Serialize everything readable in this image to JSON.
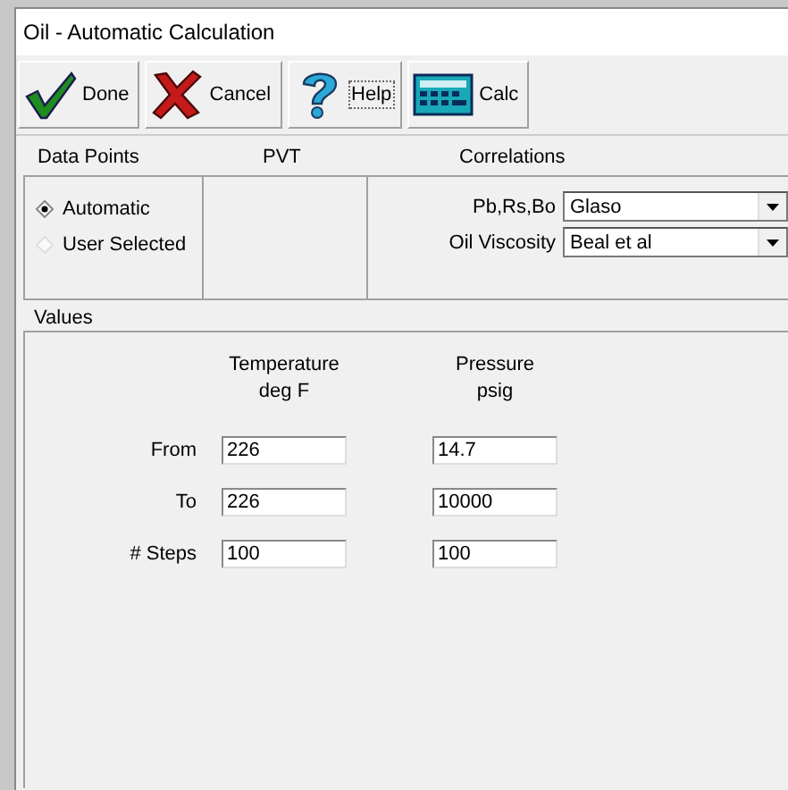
{
  "window": {
    "title": "Oil - Automatic Calculation"
  },
  "toolbar": [
    {
      "kind": "done",
      "label": "Done"
    },
    {
      "kind": "cancel",
      "label": "Cancel"
    },
    {
      "kind": "help",
      "label": "Help"
    },
    {
      "kind": "calc",
      "label": "Calc"
    }
  ],
  "data_points": {
    "heading": "Data Points",
    "options": [
      {
        "label": "Automatic",
        "selected": true
      },
      {
        "label": "User Selected",
        "selected": false
      }
    ]
  },
  "pvt": {
    "heading": "PVT"
  },
  "correlations": {
    "heading": "Correlations",
    "fields": [
      {
        "label": "Pb,Rs,Bo",
        "value": "Glaso"
      },
      {
        "label": "Oil Viscosity",
        "value": "Beal et al"
      }
    ]
  },
  "values": {
    "heading": "Values",
    "columns": [
      {
        "name": "Temperature",
        "unit": "deg F"
      },
      {
        "name": "Pressure",
        "unit": "psig"
      }
    ],
    "rows": [
      {
        "label": "From",
        "values": [
          "226",
          "14.7"
        ]
      },
      {
        "label": "To",
        "values": [
          "226",
          "10000"
        ]
      },
      {
        "label": "# Steps",
        "values": [
          "100",
          "100"
        ]
      }
    ]
  }
}
